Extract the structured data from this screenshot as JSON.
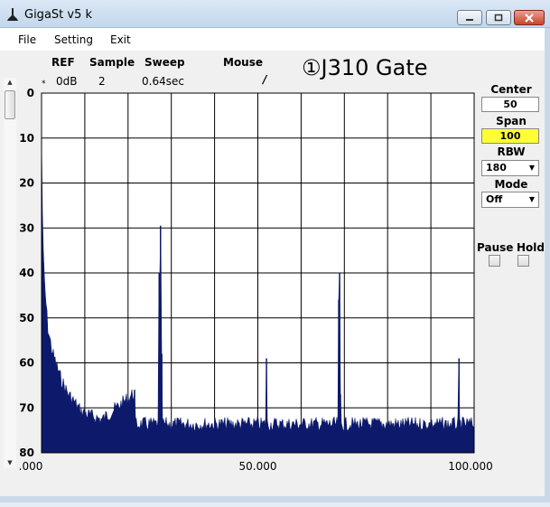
{
  "window": {
    "title": "GigaSt v5 k",
    "controls": [
      "minimize-icon",
      "maximize-icon",
      "close-icon"
    ]
  },
  "menu": {
    "items": [
      "File",
      "Setting",
      "Exit"
    ]
  },
  "header": {
    "ref_label": "REF",
    "ref_value": "0dB",
    "sample_label": "Sample",
    "sample_value": "2",
    "sweep_label": "Sweep",
    "sweep_value": "0.64sec",
    "mouse_label": "Mouse",
    "mouse_value": "/",
    "marker_star": "*",
    "annotation": "①J310 Gate"
  },
  "panel": {
    "center_label": "Center",
    "center_value": "50",
    "span_label": "Span",
    "span_value": "100",
    "rbw_label": "RBW",
    "rbw_value": "180",
    "mode_label": "Mode",
    "mode_value": "Off",
    "pause_label": "Pause",
    "hold_label": "Hold",
    "pause_checked": false,
    "hold_checked": false,
    "span_highlight_color": "#ffff33"
  },
  "chart_data": {
    "type": "area",
    "ylabels": [
      "0",
      "10",
      "20",
      "30",
      "40",
      "50",
      "60",
      "70",
      "80"
    ],
    "xlabels": [
      ".000",
      "50.000",
      "100.000"
    ],
    "xlim": [
      0,
      100
    ],
    "ylim": [
      0,
      80
    ],
    "y_inverted": true,
    "grid": true,
    "grid_divisions": {
      "x": 10,
      "y": 8
    },
    "noise_floor_db": 73,
    "fill_color": "#0d1a6b",
    "series": [
      {
        "values": [
          {
            "x": 0.0,
            "y": 10
          },
          {
            "x": 0.3,
            "y": 33
          },
          {
            "x": 0.7,
            "y": 42
          },
          {
            "x": 1.5,
            "y": 52
          },
          {
            "x": 2.5,
            "y": 57
          },
          {
            "x": 3.5,
            "y": 60
          },
          {
            "x": 4.5,
            "y": 63
          },
          {
            "x": 6.0,
            "y": 66
          },
          {
            "x": 7.5,
            "y": 68
          },
          {
            "x": 9.0,
            "y": 70
          },
          {
            "x": 11.0,
            "y": 71
          },
          {
            "x": 14.0,
            "y": 72
          },
          {
            "x": 21.5,
            "y": 66
          },
          {
            "x": 27.2,
            "y": 40
          },
          {
            "x": 27.5,
            "y": 29.5
          },
          {
            "x": 27.8,
            "y": 58
          },
          {
            "x": 52.0,
            "y": 59
          },
          {
            "x": 68.7,
            "y": 46
          },
          {
            "x": 68.9,
            "y": 40
          },
          {
            "x": 69.1,
            "y": 67
          },
          {
            "x": 96.5,
            "y": 59
          }
        ]
      }
    ]
  }
}
